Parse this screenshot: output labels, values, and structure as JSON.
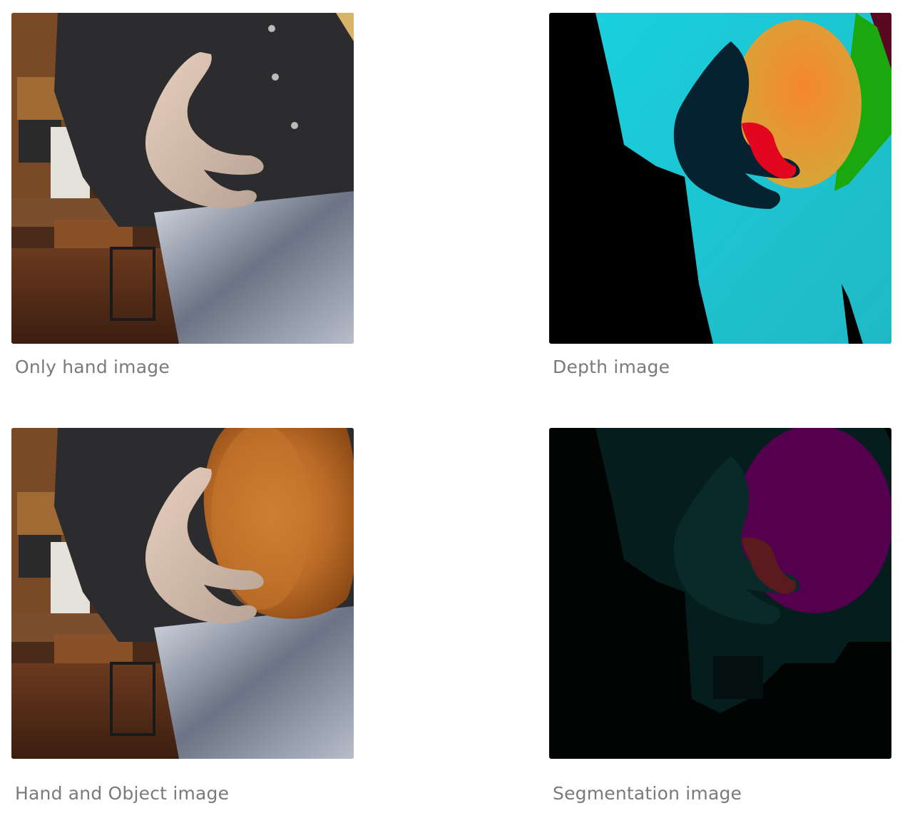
{
  "figures": [
    {
      "caption": "Only hand image"
    },
    {
      "caption": "Depth image"
    },
    {
      "caption": "Hand and Object image"
    },
    {
      "caption": "Segmentation image"
    }
  ],
  "colors": {
    "caption_text": "#7a7a7a",
    "depth_body": "#1ecad8",
    "depth_object": "#f08a32",
    "depth_hand": "#062230",
    "segmentation_object": "#55004f",
    "segmentation_body": "#062524"
  }
}
